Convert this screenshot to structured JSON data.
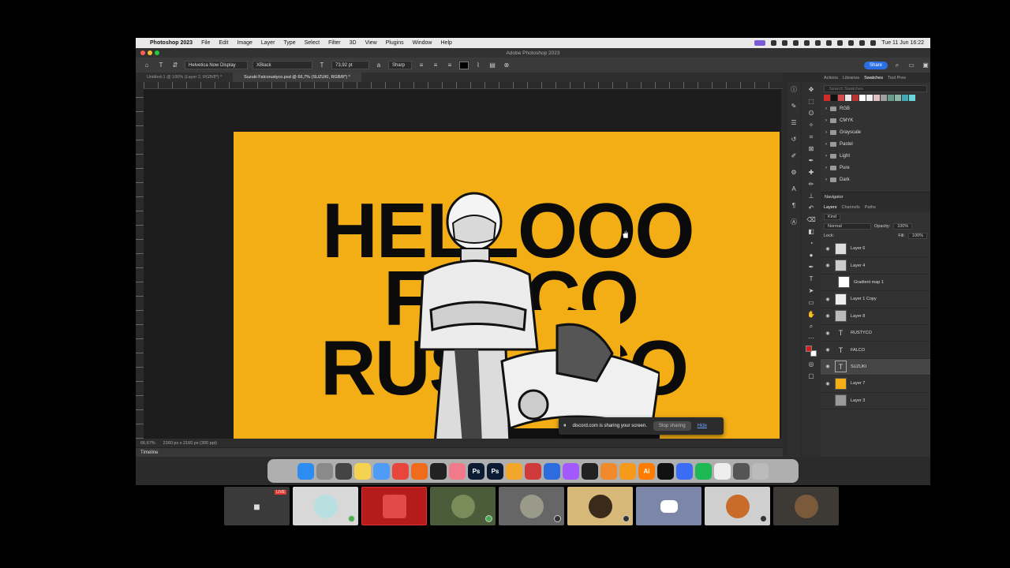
{
  "menubar": {
    "app_name": "Photoshop 2023",
    "items": [
      "File",
      "Edit",
      "Image",
      "Layer",
      "Type",
      "Select",
      "Filter",
      "3D",
      "View",
      "Plugins",
      "Window",
      "Help"
    ],
    "clock": "Tue 11 Jun  16:22"
  },
  "window": {
    "title": "Adobe Photoshop 2023"
  },
  "options": {
    "font_family": "Helvetica Now Display",
    "font_style": "XBlack",
    "font_size": "73,92 pt",
    "antialias": "Sharp",
    "share_label": "Share"
  },
  "documents": {
    "tabs": [
      {
        "label": "Untitled-1 @ 100% (Layer 2, RGB/8*) *"
      },
      {
        "label": "Suzuki Falcorustyco.psd @ 66,7% (SUZUKI, RGB/8*) *"
      }
    ]
  },
  "canvas": {
    "line1": "HELLOOO",
    "line2": "FALCO",
    "line3": "RUSTYCO",
    "background_color": "#f2ae14"
  },
  "toast": {
    "message": "discord.com is sharing your screen.",
    "stop_label": "Stop sharing",
    "hide_label": "Hide"
  },
  "status": {
    "zoom": "66,67%",
    "doc_size": "2160 px x 2160 px (300 ppi)"
  },
  "timeline": {
    "label": "Timeline"
  },
  "panels": {
    "top_tabs": [
      "Actions",
      "Libraries",
      "Swatches",
      "Tool Pres"
    ],
    "search_placeholder": "Search Swatches",
    "swatch_colors": [
      "#d42a2a",
      "#111111",
      "#d44a4a",
      "#e8e8e8",
      "#b83232",
      "#ffffff",
      "#f0f0f0",
      "#e0c2c2",
      "#a0a0a0",
      "#6a9a8a",
      "#8cb8a8",
      "#3fa9b5",
      "#6ad3d8"
    ],
    "folders": [
      "RGB",
      "CMYK",
      "Grayscale",
      "Pastel",
      "Light",
      "Pure",
      "Dark"
    ],
    "navigator": "Navigator",
    "layer_tabs": [
      "Layers",
      "Channels",
      "Paths"
    ],
    "kind_label": "Kind",
    "blend_mode": "Normal",
    "opacity_label": "Opacity:",
    "opacity": "100%",
    "lock_label": "Lock:",
    "fill_label": "Fill:",
    "fill": "100%",
    "layers": [
      "Layer 6",
      "Layer 4",
      "Gradient map 1",
      "Layer 1 Copy",
      "Layer 8",
      "RUSTYCO",
      "FALCO",
      "SUZUKI",
      "Layer 7",
      "Layer 3"
    ]
  },
  "dock": {
    "apps": [
      "Finder",
      "Launchpad",
      "Mission Control",
      "Notes",
      "Freeform",
      "Chrome",
      "Firefox",
      "ChatGPT",
      "Arc",
      "Ps",
      "Ps",
      "Sketch",
      "Creative Cloud",
      "Keynote",
      "Figma",
      "Obsidian",
      "Blender",
      "Sublime",
      "Ai",
      "Notion",
      "Webflow",
      "Spotify",
      "Documents",
      "Screen",
      "Trash"
    ]
  },
  "video": {
    "live_label": "LIVE"
  }
}
